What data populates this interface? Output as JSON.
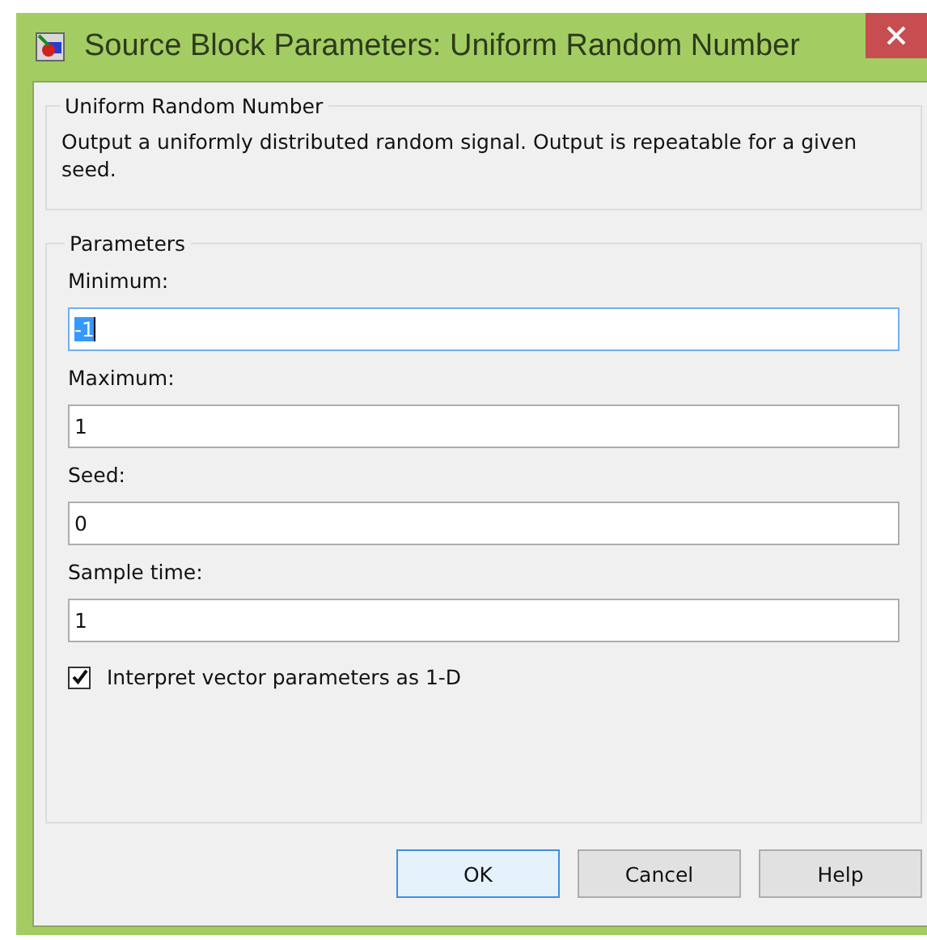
{
  "window": {
    "title": "Source Block Parameters: Uniform Random Number"
  },
  "description_group": {
    "title": "Uniform Random Number",
    "text": "Output a uniformly distributed random signal.  Output is repeatable for a given seed."
  },
  "parameters_group": {
    "title": "Parameters",
    "fields": [
      {
        "label": "Minimum:",
        "value": "-1",
        "focused": true
      },
      {
        "label": "Maximum:",
        "value": "1",
        "focused": false
      },
      {
        "label": "Seed:",
        "value": "0",
        "focused": false
      },
      {
        "label": "Sample time:",
        "value": "1",
        "focused": false
      }
    ],
    "checkbox": {
      "label": "Interpret vector parameters as 1-D",
      "checked": true
    }
  },
  "buttons": [
    {
      "label": "OK",
      "default": true
    },
    {
      "label": "Cancel",
      "default": false
    },
    {
      "label": "Help",
      "default": false
    }
  ]
}
